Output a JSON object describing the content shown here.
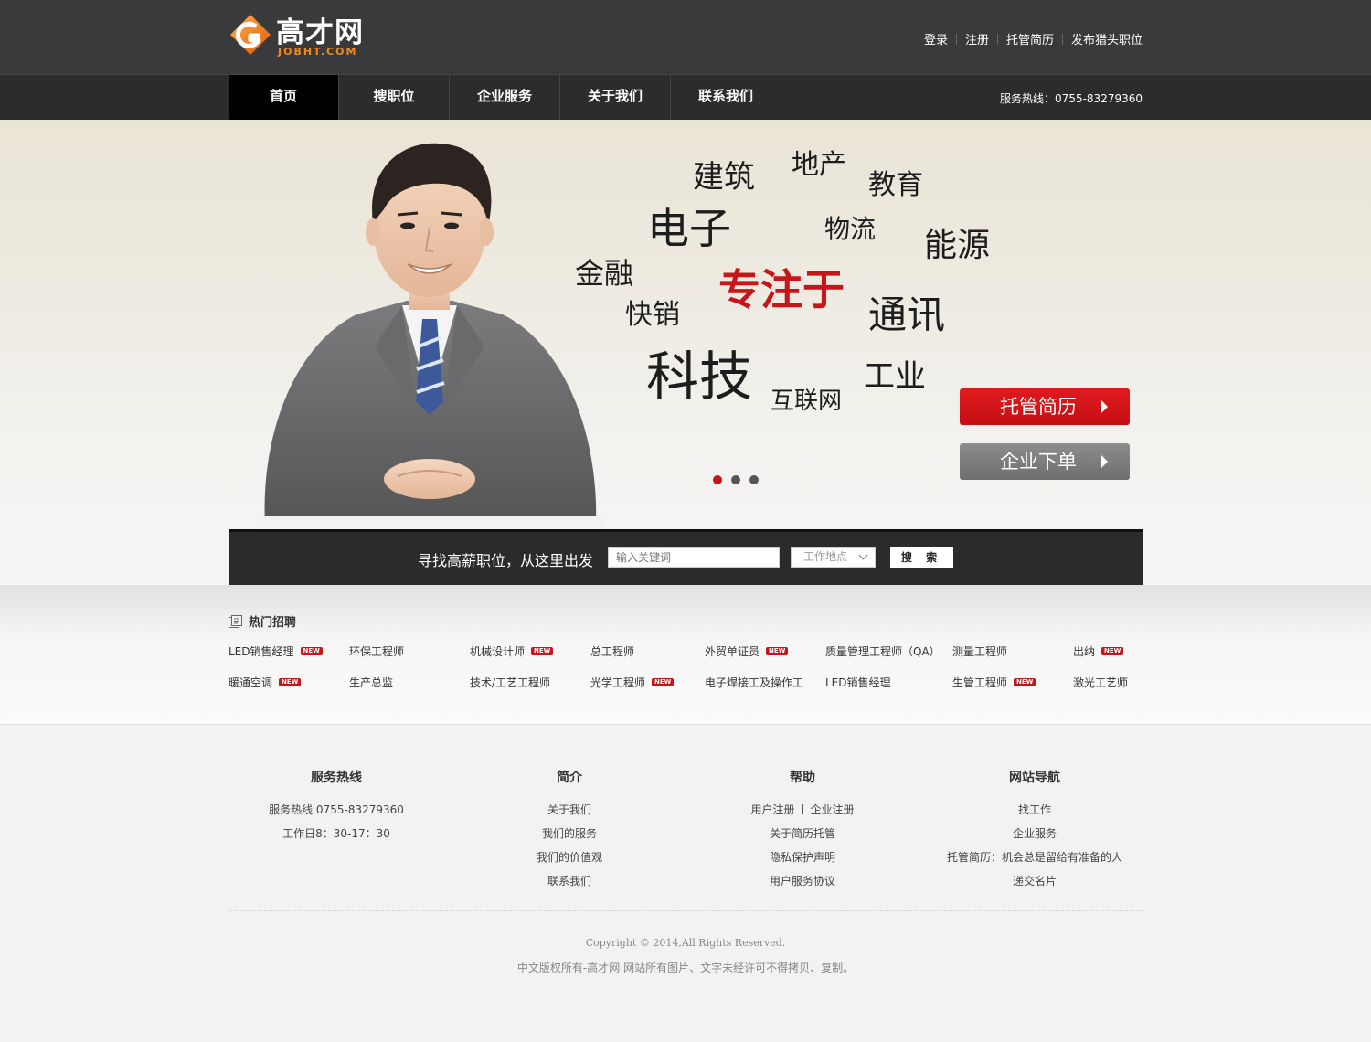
{
  "header": {
    "logo_cn": "高才网",
    "logo_en": "JOBHT.COM",
    "top_links": [
      "登录",
      "注册",
      "托管简历",
      "发布猎头职位"
    ]
  },
  "nav": {
    "items": [
      "首页",
      "搜职位",
      "企业服务",
      "关于我们",
      "联系我们"
    ],
    "active": "首页",
    "hotline": "服务热线：0755-83279360"
  },
  "banner": {
    "words": [
      "建筑",
      "地产",
      "教育",
      "电子",
      "物流",
      "能源",
      "金融",
      "专注于",
      "快销",
      "通讯",
      "科技",
      "工业",
      "互联网"
    ],
    "focus_word": "专注于",
    "btn_resume": "托管简历",
    "btn_order": "企业下单",
    "slides": 3,
    "active_slide": 1
  },
  "search": {
    "slogan": "寻找高薪职位，从这里出发",
    "keyword_placeholder": "输入关键词",
    "location": "工作地点",
    "button": "搜 索"
  },
  "hot": {
    "title": "热门招聘",
    "new_badge": "NEW",
    "jobs": [
      {
        "name": "LED销售经理",
        "new": true
      },
      {
        "name": "环保工程师",
        "new": false
      },
      {
        "name": "机械设计师",
        "new": true
      },
      {
        "name": "总工程师",
        "new": false
      },
      {
        "name": "外贸单证员",
        "new": true
      },
      {
        "name": "质量管理工程师（QA）",
        "new": false
      },
      {
        "name": "测量工程师",
        "new": false
      },
      {
        "name": "出纳",
        "new": true
      },
      {
        "name": "暖通空调",
        "new": true
      },
      {
        "name": "生产总监",
        "new": false
      },
      {
        "name": "技术/工艺工程师",
        "new": false
      },
      {
        "name": "光学工程师",
        "new": true
      },
      {
        "name": "电子焊接工及操作工",
        "new": false
      },
      {
        "name": "LED销售经理",
        "new": false
      },
      {
        "name": "生管工程师",
        "new": true
      },
      {
        "name": "激光工艺师",
        "new": false
      }
    ]
  },
  "footer": {
    "cols": [
      {
        "title": "服务热线",
        "links": [
          "服务热线 0755-83279360",
          "工作日8：30-17：30"
        ]
      },
      {
        "title": "简介",
        "links": [
          "关于我们",
          "我们的服务",
          "我们的价值观",
          "联系我们"
        ]
      },
      {
        "title": "帮助",
        "links": [
          "用户注册",
          "企业注册",
          "关于简历托管",
          "隐私保护声明",
          "用户服务协议"
        ]
      },
      {
        "title": "网站导航",
        "links": [
          "找工作",
          "企业服务",
          "托管简历：机会总是留给有准备的人",
          "递交名片"
        ]
      }
    ],
    "copyright": "Copyright © 2014,All Rights Reserved.",
    "notice": "中文版权所有-高才网 网站所有图片、文字未经许可不得拷贝、复制。"
  },
  "colors": {
    "brand_red": "#c6161a",
    "logo_orange": "#f08a1e",
    "header_bg": "#3a3a3c",
    "nav_bg": "#2c2c2c"
  }
}
